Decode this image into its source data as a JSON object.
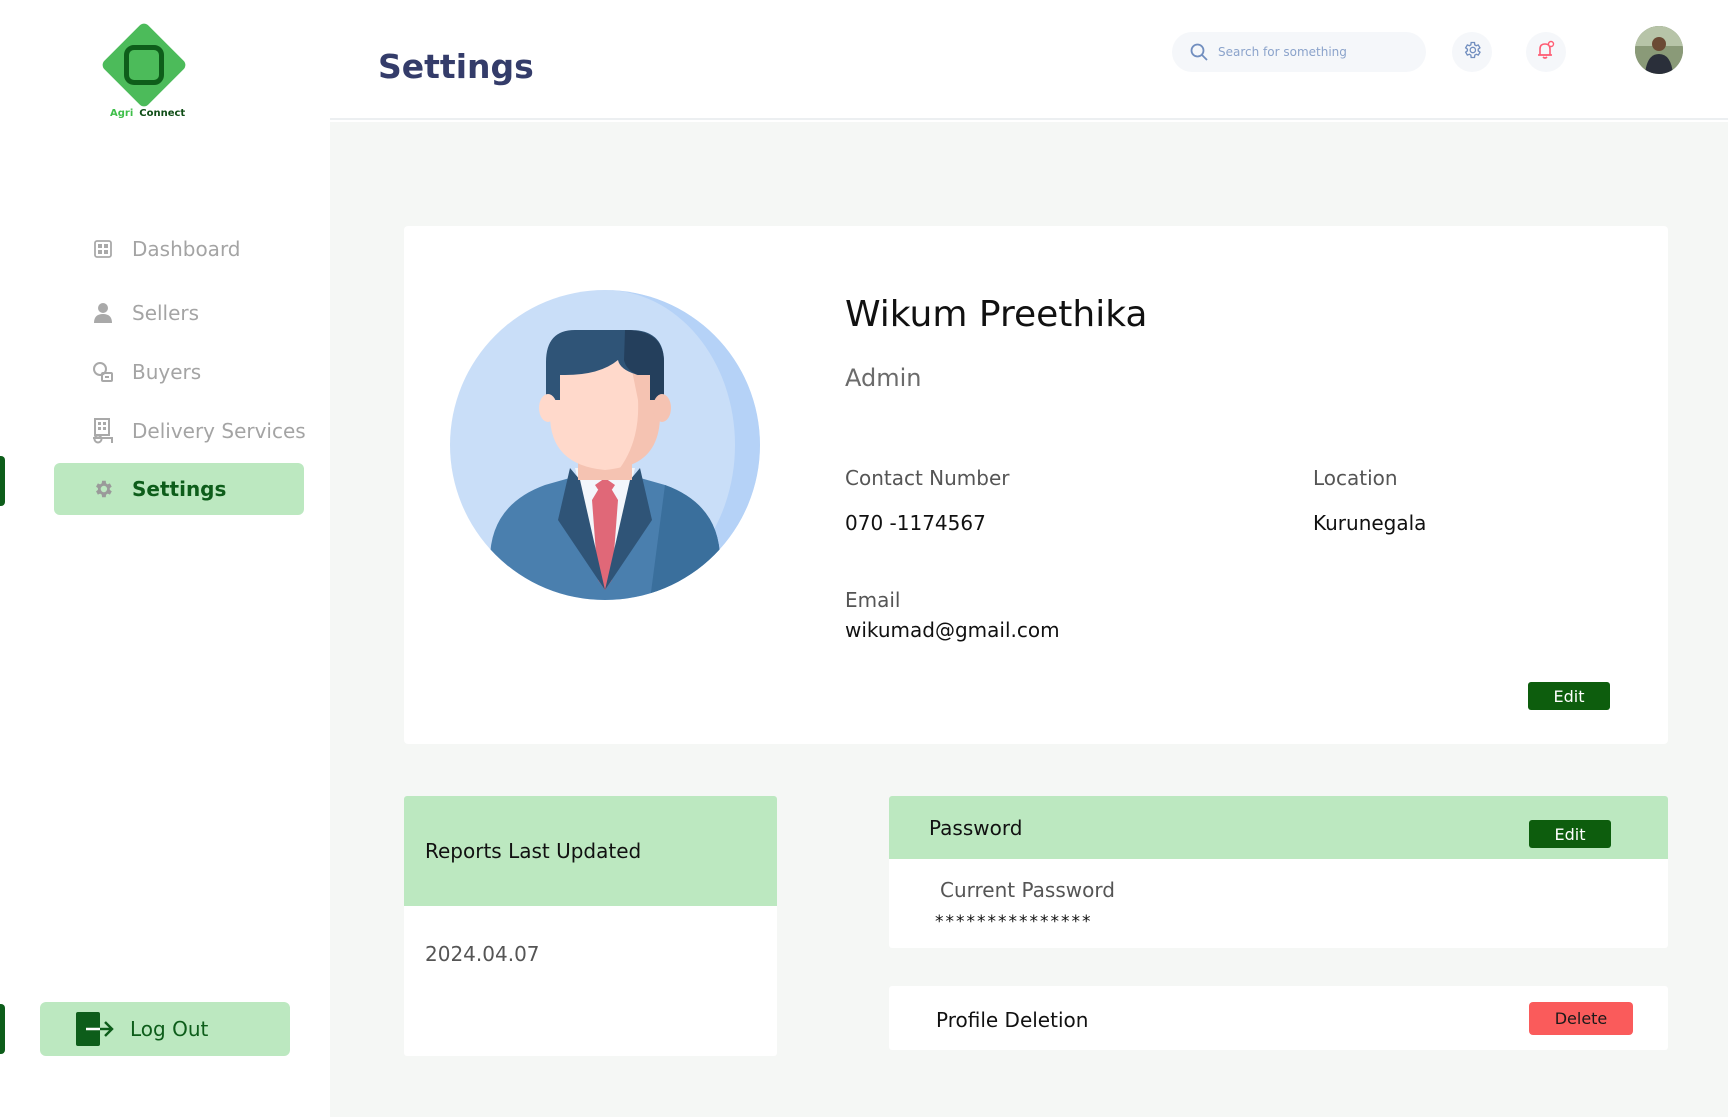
{
  "brand": {
    "word1": "Agri",
    "word2": "Connect"
  },
  "sidebar": {
    "items": [
      {
        "label": "Dashboard",
        "icon": "dashboard-icon"
      },
      {
        "label": "Sellers",
        "icon": "user-icon"
      },
      {
        "label": "Buyers",
        "icon": "buyer-icon"
      },
      {
        "label": "Delivery Services",
        "icon": "delivery-icon"
      },
      {
        "label": "Settings",
        "icon": "gear-icon",
        "active": true
      }
    ],
    "logout_label": "Log Out"
  },
  "header": {
    "title": "Settings",
    "search_placeholder": "Search for something"
  },
  "profile": {
    "name": "Wikum Preethika",
    "role": "Admin",
    "contact_label": "Contact Number",
    "contact_value": "070 -1174567",
    "location_label": "Location",
    "location_value": "Kurunegala",
    "email_label": "Email",
    "email_value": "wikumad@gmail.com",
    "edit_label": "Edit"
  },
  "reports": {
    "title": "Reports Last Updated",
    "date": "2024.04.07"
  },
  "password": {
    "title": "Password",
    "edit_label": "Edit",
    "current_label": "Current Password",
    "current_value": "***************"
  },
  "deletion": {
    "label": "Profile Deletion",
    "button_label": "Delete"
  },
  "colors": {
    "accent_dark": "#0d5d0d",
    "accent_light": "#bce8c0",
    "danger": "#fa5b5b",
    "title": "#343c6a"
  }
}
